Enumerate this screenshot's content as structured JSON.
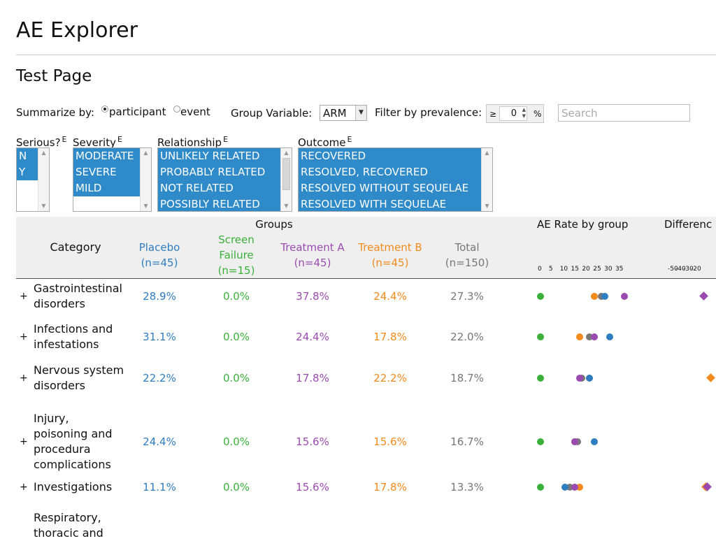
{
  "app_title": "AE Explorer",
  "page_title": "Test Page",
  "controls": {
    "summarize_label": "Summarize by:",
    "summarize_options": [
      "participant",
      "event"
    ],
    "summarize_selected": "participant",
    "group_label": "Group Variable:",
    "group_value": "ARM",
    "prevalence_label": "Filter by prevalence:",
    "prevalence_operator": "≥",
    "prevalence_value": "0",
    "prevalence_unit": "%",
    "search_placeholder": "Search"
  },
  "filters": [
    {
      "label": "Serious?",
      "sup": "E",
      "options": [
        "N",
        "Y"
      ]
    },
    {
      "label": "Severity",
      "sup": "E",
      "options": [
        "MODERATE",
        "SEVERE",
        "MILD"
      ]
    },
    {
      "label": "Relationship",
      "sup": "E",
      "options": [
        "UNLIKELY RELATED",
        "PROBABLY RELATED",
        "NOT RELATED",
        "POSSIBLY RELATED"
      ]
    },
    {
      "label": "Outcome",
      "sup": "E",
      "options": [
        "RECOVERED",
        "RESOLVED, RECOVERED",
        "RESOLVED WITHOUT SEQUELAE",
        "RESOLVED WITH SEQUELAE"
      ]
    }
  ],
  "table": {
    "groups_label": "Groups",
    "category_label": "Category",
    "rate_label": "AE Rate by group",
    "diff_label": "Differenc",
    "columns": [
      {
        "name": "Placebo",
        "n": "(n=45)",
        "color": "#2f7dc1"
      },
      {
        "name": "Screen Failure",
        "n": "(n=15)",
        "color": "#3ab03a"
      },
      {
        "name": "Treatment A",
        "n": "(n=45)",
        "color": "#9b4bb0"
      },
      {
        "name": "Treatment B",
        "n": "(n=45)",
        "color": "#f28a1c"
      },
      {
        "name": "Total",
        "n": "(n=150)",
        "color": "#777777"
      }
    ],
    "rate_axis_ticks": [
      "0",
      "5",
      "10",
      "15",
      "20",
      "25",
      "30",
      "35"
    ],
    "diff_axis_ticks": [
      "-50",
      "-40",
      "-30",
      "-20"
    ],
    "rows": [
      {
        "expand": "+",
        "category": [
          "Gastrointestinal",
          "disorders"
        ],
        "values": [
          "28.9%",
          "0.0%",
          "37.8%",
          "24.4%",
          "27.3%"
        ],
        "rates": [
          28.9,
          0.0,
          37.8,
          24.4,
          27.3
        ]
      },
      {
        "expand": "+",
        "category": [
          "Infections and",
          "infestations"
        ],
        "values": [
          "31.1%",
          "0.0%",
          "24.4%",
          "17.8%",
          "22.0%"
        ],
        "rates": [
          31.1,
          0.0,
          24.4,
          17.8,
          22.0
        ]
      },
      {
        "expand": "+",
        "category": [
          "Nervous system",
          "disorders"
        ],
        "values": [
          "22.2%",
          "0.0%",
          "17.8%",
          "22.2%",
          "18.7%"
        ],
        "rates": [
          22.2,
          0.0,
          17.8,
          22.2,
          18.7
        ]
      },
      {
        "expand": "+",
        "category": [
          "Injury,",
          "poisoning and",
          "procedura",
          "complications"
        ],
        "values": [
          "24.4%",
          "0.0%",
          "15.6%",
          "15.6%",
          "16.7%"
        ],
        "rates": [
          24.4,
          0.0,
          15.6,
          15.6,
          16.7
        ]
      },
      {
        "expand": "+",
        "category": [
          "Investigations"
        ],
        "values": [
          "11.1%",
          "0.0%",
          "15.6%",
          "17.8%",
          "13.3%"
        ],
        "rates": [
          11.1,
          0.0,
          15.6,
          17.8,
          13.3
        ]
      },
      {
        "expand": "",
        "category": [
          "Respiratory,",
          "thoracic and"
        ],
        "values": [
          "",
          "",
          "",
          "",
          ""
        ],
        "rates": []
      }
    ]
  }
}
